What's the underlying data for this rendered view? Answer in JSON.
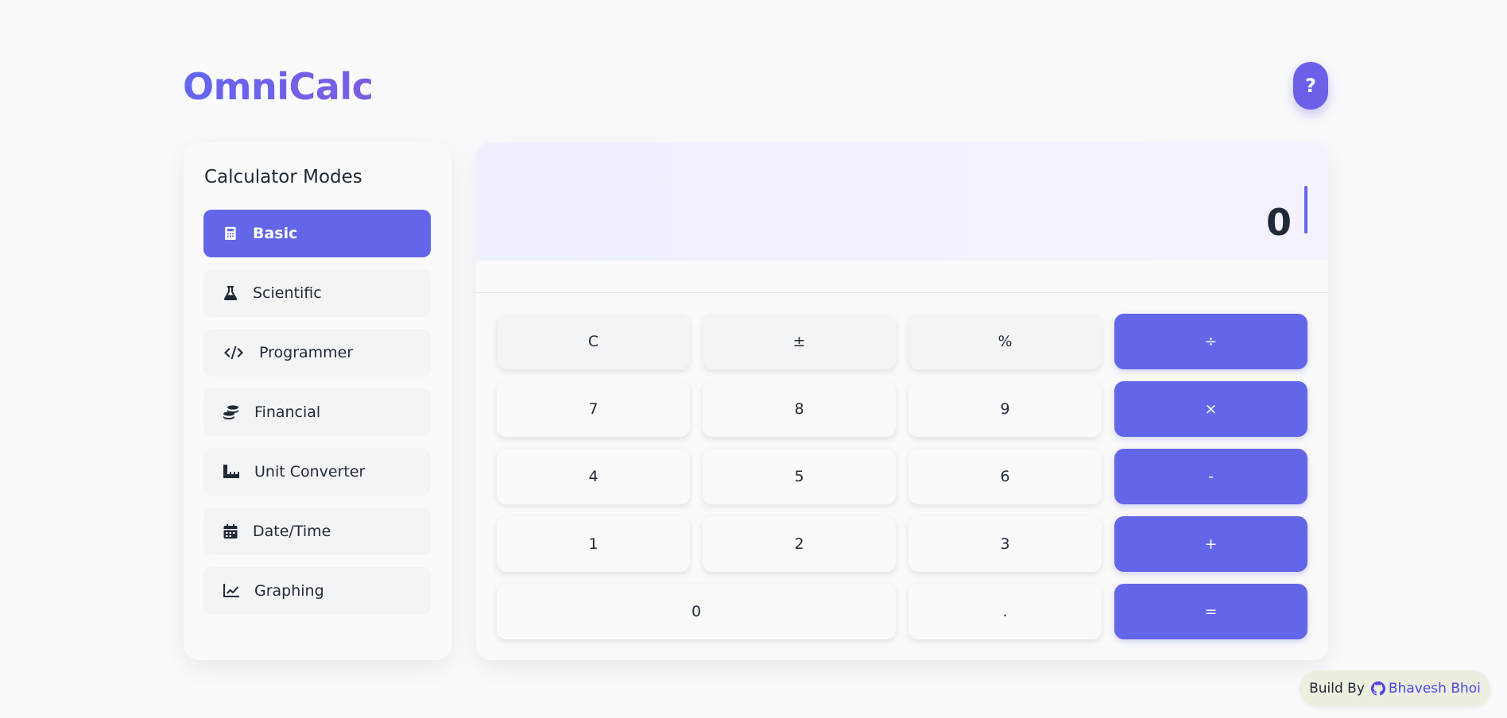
{
  "app": {
    "title": "OmniCalc",
    "help_label": "?"
  },
  "sidebar": {
    "title": "Calculator Modes",
    "items": [
      {
        "label": "Basic",
        "icon": "calculator-icon",
        "active": true
      },
      {
        "label": "Scientific",
        "icon": "flask-icon",
        "active": false
      },
      {
        "label": "Programmer",
        "icon": "code-icon",
        "active": false
      },
      {
        "label": "Financial",
        "icon": "coins-icon",
        "active": false
      },
      {
        "label": "Unit Converter",
        "icon": "ruler-icon",
        "active": false
      },
      {
        "label": "Date/Time",
        "icon": "calendar-icon",
        "active": false
      },
      {
        "label": "Graphing",
        "icon": "chart-line-icon",
        "active": false
      }
    ]
  },
  "display": {
    "value": "0"
  },
  "keypad": {
    "keys": [
      "C",
      "±",
      "%",
      "÷",
      "7",
      "8",
      "9",
      "×",
      "4",
      "5",
      "6",
      "-",
      "1",
      "2",
      "3",
      "+",
      "0",
      ".",
      "="
    ]
  },
  "footer": {
    "prefix": "Build By",
    "author": "Bhavesh Bhoi",
    "icon": "github-icon"
  },
  "colors": {
    "accent": "#6366e8",
    "title": "#6c5ce7",
    "background": "#f9fafb"
  }
}
